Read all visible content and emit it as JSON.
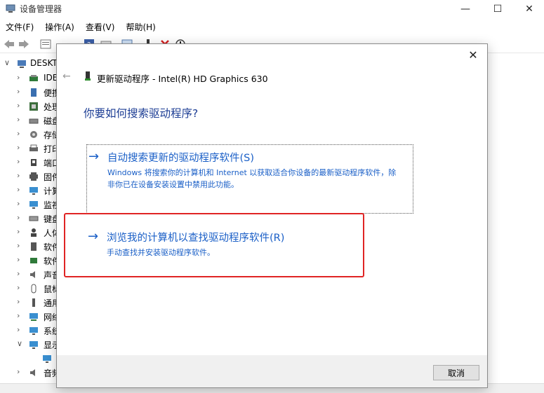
{
  "window": {
    "title": "设备管理器",
    "minimize": "—",
    "maximize": "☐",
    "close": "✕"
  },
  "menu": [
    "文件(F)",
    "操作(A)",
    "查看(V)",
    "帮助(H)"
  ],
  "tree": {
    "root": "DESKT",
    "items": [
      "IDE",
      "便携",
      "处理",
      "磁盘",
      "存储",
      "打印",
      "端口",
      "固件",
      "计算",
      "监视",
      "键盘",
      "人体",
      "软件",
      "软件",
      "声音",
      "鼠标",
      "通用",
      "网络",
      "系统",
      "显示",
      "",
      "音频"
    ]
  },
  "dialog": {
    "close": "✕",
    "back": "←",
    "title": "更新驱动程序 - Intel(R) HD Graphics 630",
    "question": "你要如何搜索驱动程序?",
    "option1": {
      "arrow": "→",
      "heading": "自动搜索更新的驱动程序软件(S)",
      "description": "Windows 将搜索你的计算机和 Internet 以获取适合你设备的最新驱动程序软件，除非你已在设备安装设置中禁用此功能。"
    },
    "option2": {
      "arrow": "→",
      "heading": "浏览我的计算机以查找驱动程序软件(R)",
      "description": "手动查找并安装驱动程序软件。"
    },
    "cancel": "取消"
  },
  "colors": {
    "link": "#1a5fc7",
    "question": "#1c3d94",
    "highlight": "#e02424"
  }
}
